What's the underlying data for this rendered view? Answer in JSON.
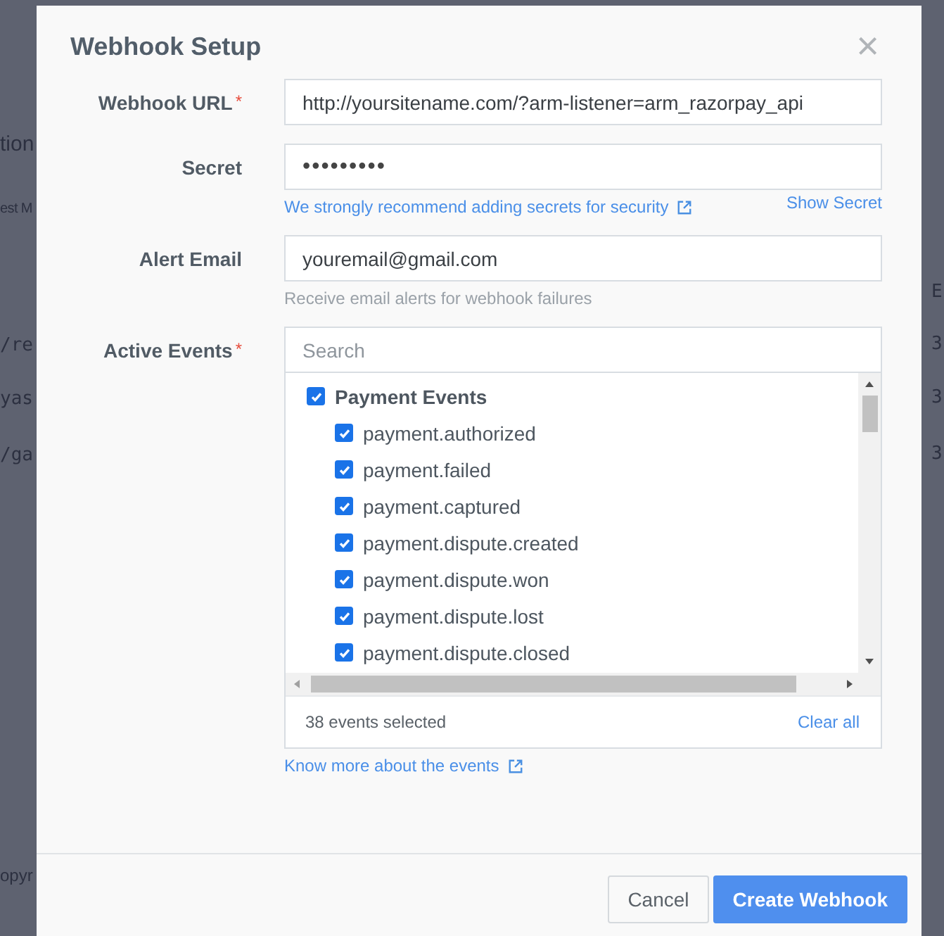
{
  "background": {
    "left_fragments": [
      "tion",
      "est M",
      "/re",
      "yas",
      "/ga",
      "opyr"
    ],
    "right_fragments": [
      "E",
      "3",
      "3",
      "3"
    ]
  },
  "dialog": {
    "title": "Webhook Setup",
    "close": "×",
    "fields": [
      {
        "label": "Webhook URL",
        "required_mark": "*",
        "value": "http://yoursitename.com/?arm-listener=arm_razorpay_api",
        "kind": "text"
      },
      {
        "label": "Secret",
        "value": "•••••••••",
        "kind": "password",
        "hint_link": "We strongly recommend adding secrets for security",
        "action": "Show Secret"
      },
      {
        "label": "Alert Email",
        "value": "youremail@gmail.com",
        "kind": "text",
        "hint": "Receive email alerts for webhook failures"
      }
    ],
    "events": {
      "label": "Active Events",
      "required_mark": "*",
      "search": {
        "placeholder": "Search"
      },
      "groups": [
        {
          "label": "Payment Events",
          "checked": true,
          "children": [
            {
              "label": "payment.authorized",
              "checked": true
            },
            {
              "label": "payment.failed",
              "checked": true
            },
            {
              "label": "payment.captured",
              "checked": true
            },
            {
              "label": "payment.dispute.created",
              "checked": true
            },
            {
              "label": "payment.dispute.won",
              "checked": true
            },
            {
              "label": "payment.dispute.lost",
              "checked": true
            },
            {
              "label": "payment.dispute.closed",
              "checked": true
            }
          ]
        }
      ],
      "count": "38 events selected",
      "clear": "Clear all",
      "more_link": "Know more about the events"
    },
    "buttons": [
      {
        "label": "Cancel",
        "kind": "secondary"
      },
      {
        "label": "Create Webhook",
        "kind": "primary"
      }
    ]
  }
}
